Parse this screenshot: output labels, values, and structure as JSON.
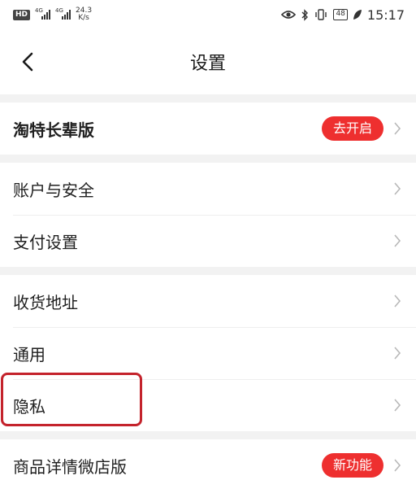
{
  "status_bar": {
    "chip": "HD",
    "signal1_tag": "4G",
    "signal2_tag": "4G",
    "speed_value": "24.3",
    "speed_unit": "K/s",
    "battery": "48",
    "time": "15:17"
  },
  "nav": {
    "title": "设置"
  },
  "groups": [
    {
      "items": [
        {
          "label": "淘特长辈版",
          "badge": "去开启"
        }
      ]
    },
    {
      "items": [
        {
          "label": "账户与安全"
        },
        {
          "label": "支付设置"
        }
      ]
    },
    {
      "items": [
        {
          "label": "收货地址"
        },
        {
          "label": "通用"
        },
        {
          "label": "隐私"
        }
      ]
    },
    {
      "items": [
        {
          "label": "商品详情微店版",
          "badge": "新功能"
        }
      ]
    }
  ],
  "colors": {
    "accent": "#ee2f2f",
    "highlight": "#c4232c",
    "background": "#f2f2f2"
  }
}
